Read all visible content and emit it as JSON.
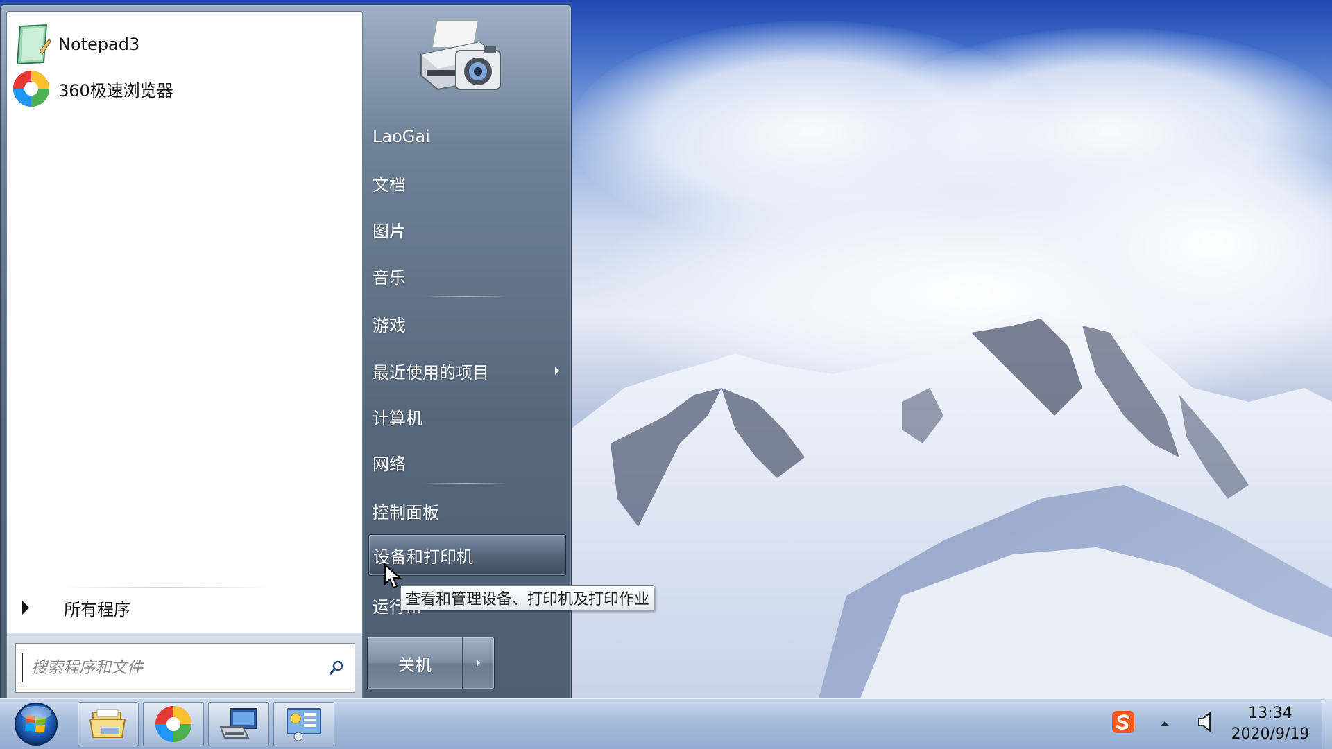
{
  "start_menu": {
    "pinned": [
      {
        "label": "Notepad3",
        "icon": "notepad-icon"
      },
      {
        "label": "360极速浏览器",
        "icon": "browser-360-icon"
      }
    ],
    "all_programs": "所有程序",
    "search_placeholder": "搜索程序和文件",
    "right_items": [
      {
        "label": "LaoGai"
      },
      {
        "label": "文档"
      },
      {
        "label": "图片"
      },
      {
        "label": "音乐"
      },
      {
        "label": "游戏"
      },
      {
        "label": "最近使用的项目",
        "has_submenu": true
      },
      {
        "label": "计算机"
      },
      {
        "label": "网络"
      },
      {
        "label": "控制面板"
      },
      {
        "label": "设备和打印机",
        "highlighted": true
      },
      {
        "label": "运行..."
      }
    ],
    "shutdown_label": "关机",
    "tooltip": "查看和管理设备、打印机及打印作业",
    "user_picture": "devices-printers-icon"
  },
  "taskbar": {
    "pinned": [
      "windows-explorer-icon",
      "browser-360-icon",
      "computer-icon",
      "control-panel-icon"
    ],
    "tray": [
      "sogou-ime-icon",
      "show-hidden-icons-arrow",
      "volume-icon"
    ],
    "time": "13:34",
    "date": "2020/9/19"
  }
}
